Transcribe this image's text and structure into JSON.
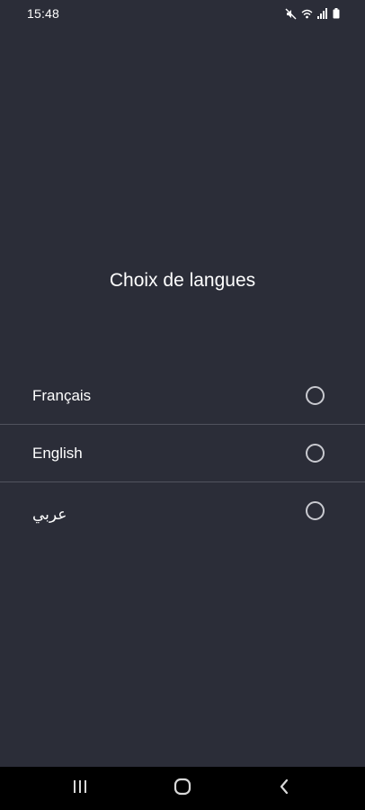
{
  "status_bar": {
    "time": "15:48",
    "icons": [
      "mute-icon",
      "wifi-icon",
      "signal-icon",
      "battery-icon"
    ]
  },
  "page": {
    "title": "Choix de langues"
  },
  "languages": [
    {
      "label": "Français",
      "selected": false
    },
    {
      "label": "English",
      "selected": false
    },
    {
      "label": "عربي",
      "selected": false
    }
  ],
  "nav_bar": {
    "buttons": [
      "recents-icon",
      "home-icon",
      "back-icon"
    ]
  },
  "colors": {
    "background": "#2b2d38",
    "text": "#ffffff",
    "divider": "#51535e",
    "radio_ring": "#c9cad0",
    "nav_bar": "#000000"
  }
}
